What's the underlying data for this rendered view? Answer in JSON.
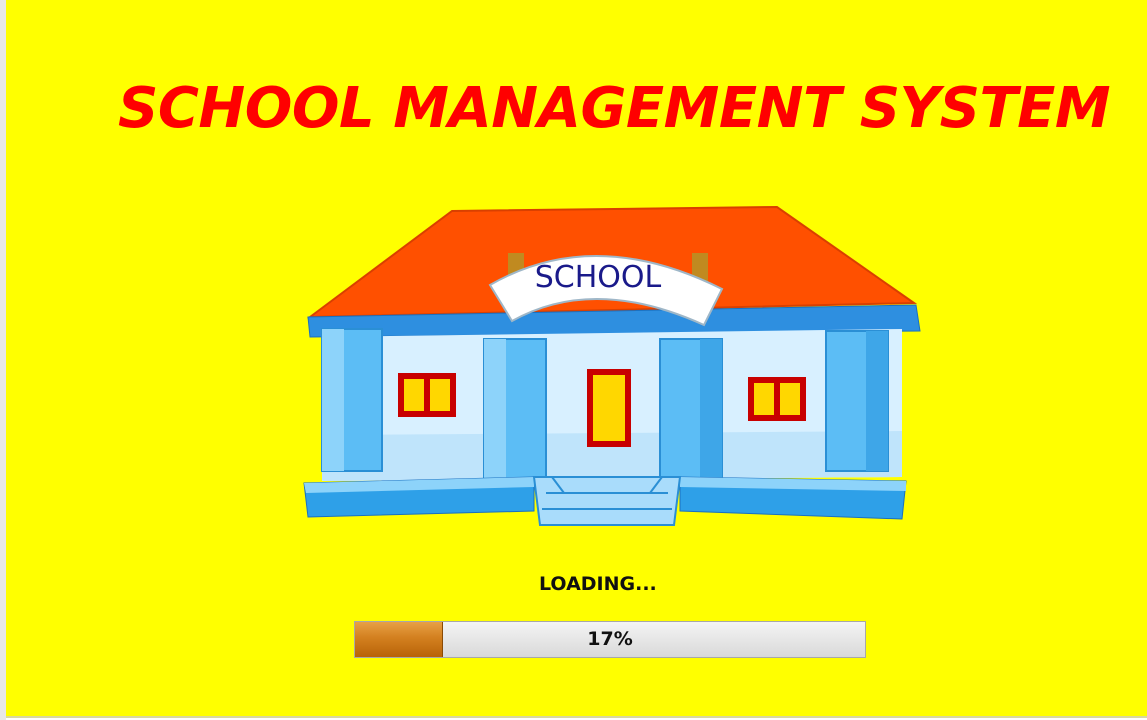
{
  "splash": {
    "title": "SCHOOL MANAGEMENT SYSTEM",
    "illustration_sign": "SCHOOL",
    "loading_label": "LOADING...",
    "progress": {
      "value_percent": 17,
      "text": "17%"
    }
  },
  "colors": {
    "background": "#ffff00",
    "title": "#ff0000",
    "roof": "#ff5000",
    "building_blue": "#2ea0e8",
    "window_frame": "#c80000",
    "window_glass": "#ffd700",
    "progress_fill": "#d3801f"
  }
}
